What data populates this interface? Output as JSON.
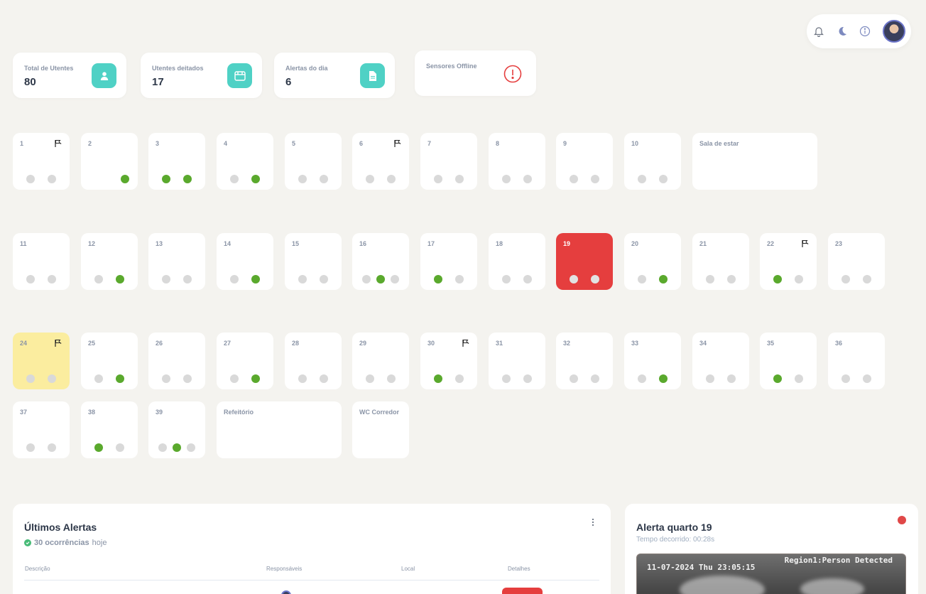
{
  "header": {
    "icons": [
      "bell-icon",
      "moon-icon",
      "info-icon"
    ],
    "avatar": "user-avatar"
  },
  "stats": [
    {
      "label": "Total de Utentes",
      "value": "80",
      "icon": "user-icon"
    },
    {
      "label": "Utentes deitados",
      "value": "17",
      "icon": "bed-icon"
    },
    {
      "label": "Alertas do dia",
      "value": "6",
      "icon": "document-icon"
    },
    {
      "label": "Sensores Offline",
      "value": "",
      "icon": "alert-circle-icon"
    }
  ],
  "rooms": [
    {
      "name": "1",
      "dots": [
        0,
        0
      ],
      "flag": true
    },
    {
      "name": "2",
      "dots": [
        1
      ],
      "flag": false
    },
    {
      "name": "3",
      "dots": [
        1,
        1
      ],
      "flag": false
    },
    {
      "name": "4",
      "dots": [
        0,
        1
      ],
      "flag": false
    },
    {
      "name": "5",
      "dots": [
        0,
        0
      ],
      "flag": false
    },
    {
      "name": "6",
      "dots": [
        0,
        0
      ],
      "flag": true
    },
    {
      "name": "7",
      "dots": [
        0,
        0
      ],
      "flag": false
    },
    {
      "name": "8",
      "dots": [
        0,
        0
      ],
      "flag": false
    },
    {
      "name": "9",
      "dots": [
        0,
        0
      ],
      "flag": false
    },
    {
      "name": "10",
      "dots": [
        0,
        0
      ],
      "flag": false
    },
    {
      "name": "Sala de estar",
      "dots": [],
      "flag": false,
      "wide": true
    },
    {
      "name": "11",
      "dots": [
        0,
        0
      ],
      "flag": false
    },
    {
      "name": "12",
      "dots": [
        0,
        1
      ],
      "flag": false
    },
    {
      "name": "13",
      "dots": [
        0,
        0
      ],
      "flag": false
    },
    {
      "name": "14",
      "dots": [
        0,
        1
      ],
      "flag": false
    },
    {
      "name": "15",
      "dots": [
        0,
        0
      ],
      "flag": false
    },
    {
      "name": "16",
      "dots": [
        0,
        1,
        0
      ],
      "flag": false
    },
    {
      "name": "17",
      "dots": [
        1,
        0
      ],
      "flag": false
    },
    {
      "name": "18",
      "dots": [
        0,
        0
      ],
      "flag": false
    },
    {
      "name": "19",
      "dots": [
        0,
        0
      ],
      "flag": false,
      "state": "alert"
    },
    {
      "name": "20",
      "dots": [
        0,
        1
      ],
      "flag": false
    },
    {
      "name": "21",
      "dots": [
        0,
        0
      ],
      "flag": false
    },
    {
      "name": "22",
      "dots": [
        1,
        0
      ],
      "flag": true
    },
    {
      "name": "23",
      "dots": [
        0,
        0
      ],
      "flag": false
    },
    {
      "name": "24",
      "dots": [
        0,
        0
      ],
      "flag": true,
      "state": "warn"
    },
    {
      "name": "25",
      "dots": [
        0,
        1
      ],
      "flag": false
    },
    {
      "name": "26",
      "dots": [
        0,
        0
      ],
      "flag": false
    },
    {
      "name": "27",
      "dots": [
        0,
        1
      ],
      "flag": false
    },
    {
      "name": "28",
      "dots": [
        0,
        0
      ],
      "flag": false
    },
    {
      "name": "29",
      "dots": [
        0,
        0
      ],
      "flag": false
    },
    {
      "name": "30",
      "dots": [
        1,
        0
      ],
      "flag": true
    },
    {
      "name": "31",
      "dots": [
        0,
        0
      ],
      "flag": false
    },
    {
      "name": "32",
      "dots": [
        0,
        0
      ],
      "flag": false
    },
    {
      "name": "33",
      "dots": [
        0,
        1
      ],
      "flag": false
    },
    {
      "name": "34",
      "dots": [
        0,
        0
      ],
      "flag": false
    },
    {
      "name": "35",
      "dots": [
        1,
        0
      ],
      "flag": false
    },
    {
      "name": "36",
      "dots": [
        0,
        0
      ],
      "flag": false
    },
    {
      "name": "37",
      "dots": [
        0,
        0
      ],
      "flag": false
    },
    {
      "name": "38",
      "dots": [
        1,
        0
      ],
      "flag": false
    },
    {
      "name": "39",
      "dots": [
        0,
        1,
        0
      ],
      "flag": false
    },
    {
      "name": "Refeitório",
      "dots": [],
      "flag": false,
      "wide": true
    },
    {
      "name": "WC Corredor",
      "dots": [],
      "flag": false
    }
  ],
  "alerts": {
    "title": "Últimos Alertas",
    "count": "30 ocorrências",
    "period": "hoje",
    "columns": [
      "Descrição",
      "Responsáveis",
      "Local",
      "Detalhes"
    ]
  },
  "camera": {
    "title": "Alerta quarto 19",
    "elapsed": "Tempo decorrido: 00:28s",
    "timestamp": "11-07-2024 Thu 23:05:15",
    "detection": "Region1:Person Detected"
  }
}
